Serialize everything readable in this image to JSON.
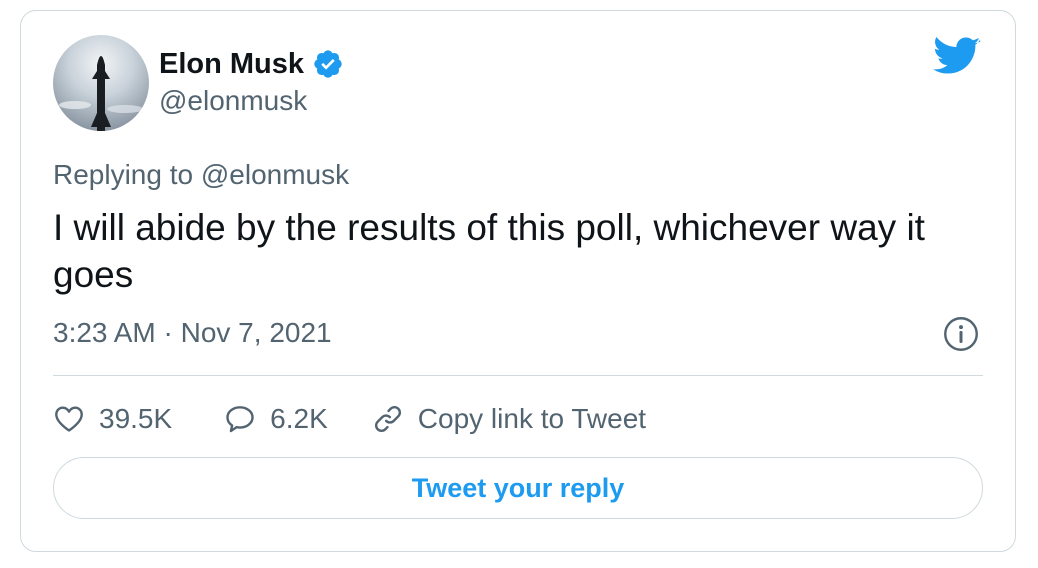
{
  "tweet": {
    "author_name": "Elon Musk",
    "author_handle": "@elonmusk",
    "verified": true,
    "replying_prefix": "Replying to",
    "replying_to": "@elonmusk",
    "text": "I will abide by the results of this poll, whichever way it goes",
    "timestamp": "3:23 AM · Nov 7, 2021"
  },
  "actions": {
    "likes": "39.5K",
    "replies": "6.2K",
    "copy_link_label": "Copy link to Tweet"
  },
  "reply_button_label": "Tweet your reply",
  "icons": {
    "brand": "twitter-bird-icon",
    "verified": "verified-badge-icon",
    "info": "info-icon",
    "like": "heart-icon",
    "reply": "speech-bubble-icon",
    "copy_link": "link-icon"
  },
  "colors": {
    "accent": "#1d9bf0",
    "text_primary": "#0f1419",
    "text_secondary": "#536471",
    "border": "#cfd9de"
  }
}
